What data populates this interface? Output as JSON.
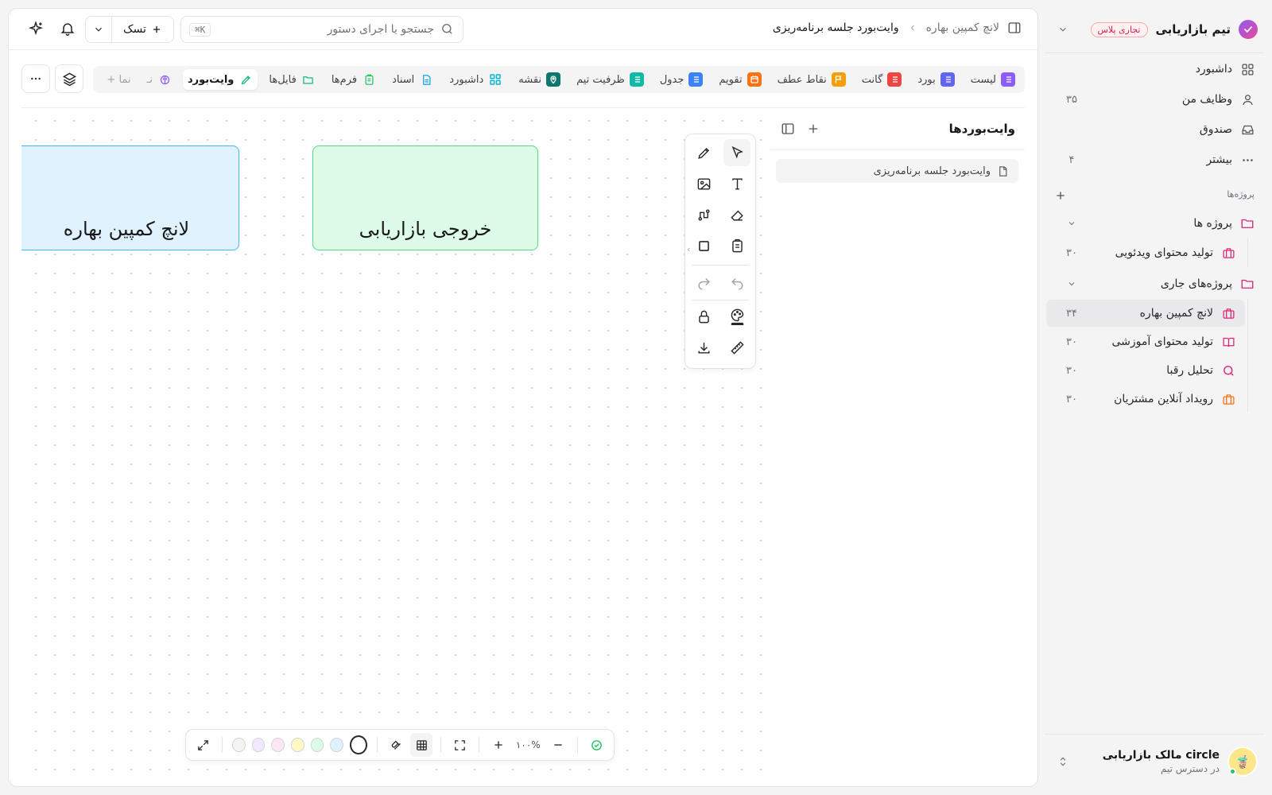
{
  "workspace": {
    "name": "تیم بازاریابی",
    "badge": "تجاری پلاس"
  },
  "nav": [
    {
      "label": "داشبورد",
      "icon": "grid-icon",
      "count": ""
    },
    {
      "label": "وظایف من",
      "icon": "user-icon",
      "count": "۳۵"
    },
    {
      "label": "صندوق",
      "icon": "inbox-icon",
      "count": ""
    },
    {
      "label": "بیشتر",
      "icon": "more-icon",
      "count": "۴"
    }
  ],
  "projects_section": {
    "label": "پروژه‌ها"
  },
  "folders": [
    {
      "label": "پروژه ها",
      "projects": [
        {
          "label": "تولید محتوای ویدئویی",
          "count": "۳۰",
          "color": "#db2777",
          "icon": "briefcase-icon"
        }
      ]
    },
    {
      "label": "پروژه‌های جاری",
      "projects": [
        {
          "label": "لانچ کمپین بهاره",
          "count": "۳۴",
          "color": "#db2777",
          "icon": "briefcase-icon",
          "active": true
        },
        {
          "label": "تولید محتوای آموزشی",
          "count": "۳۰",
          "color": "#db2777",
          "icon": "book-icon"
        },
        {
          "label": "تحلیل رقبا",
          "count": "۳۰",
          "color": "#db2777",
          "icon": "search-icon"
        },
        {
          "label": "رویداد آنلاین مشتریان",
          "count": "۳۰",
          "color": "#f97316",
          "icon": "briefcase-icon"
        }
      ]
    }
  ],
  "user": {
    "name": "مالک بازاریابی circle",
    "subtitle": "در دسترس تیم"
  },
  "breadcrumb": {
    "parent": "لانچ کمپین بهاره",
    "current": "وایت‌بورد جلسه برنامه‌ریزی"
  },
  "search": {
    "placeholder": "جستجو یا اجرای دستور",
    "shortcut": "⌘K"
  },
  "task_button": {
    "label": "تسک"
  },
  "tabs": [
    {
      "label": "لیست",
      "color": "#8b5cf6"
    },
    {
      "label": "بورد",
      "color": "#6366f1"
    },
    {
      "label": "گانت",
      "color": "#ef4444"
    },
    {
      "label": "نقاط عطف",
      "color": "#f59e0b"
    },
    {
      "label": "تقویم",
      "color": "#f97316"
    },
    {
      "label": "جدول",
      "color": "#3b82f6"
    },
    {
      "label": "ظرفیت تیم",
      "color": "#14b8a6"
    },
    {
      "label": "نقشه",
      "color": "#0f766e"
    },
    {
      "label": "داشبورد",
      "color": "#06b6d4"
    },
    {
      "label": "اسناد",
      "color": "#0ea5e9"
    },
    {
      "label": "فرم‌ها",
      "color": "#22c55e"
    },
    {
      "label": "فایل‌ها",
      "color": "#10b981"
    },
    {
      "label": "وایت‌بورد",
      "color": "#10b981",
      "active": true
    },
    {
      "label": "نـ",
      "color": "#8b5cf6",
      "faded": true
    },
    {
      "label": "+ نما",
      "color": "",
      "faded": true
    }
  ],
  "whiteboards": {
    "title": "وایت‌بوردها",
    "items": [
      "وایت‌بورد جلسه برنامه‌ریزی"
    ]
  },
  "canvas": {
    "shapes": [
      {
        "label": "لانچ کمپین بهاره",
        "fill": "#e0f2fe",
        "stroke": "#38bdf8"
      },
      {
        "label": "خروجی بازاریابی",
        "fill": "#dcfce7",
        "stroke": "#4ade80"
      }
    ]
  },
  "zoom": {
    "value": "۱۰۰%"
  },
  "swatches": [
    "#f4f4f5",
    "#f3e8ff",
    "#fce7f3",
    "#fef9c3",
    "#dcfce7",
    "#e0f2fe"
  ]
}
